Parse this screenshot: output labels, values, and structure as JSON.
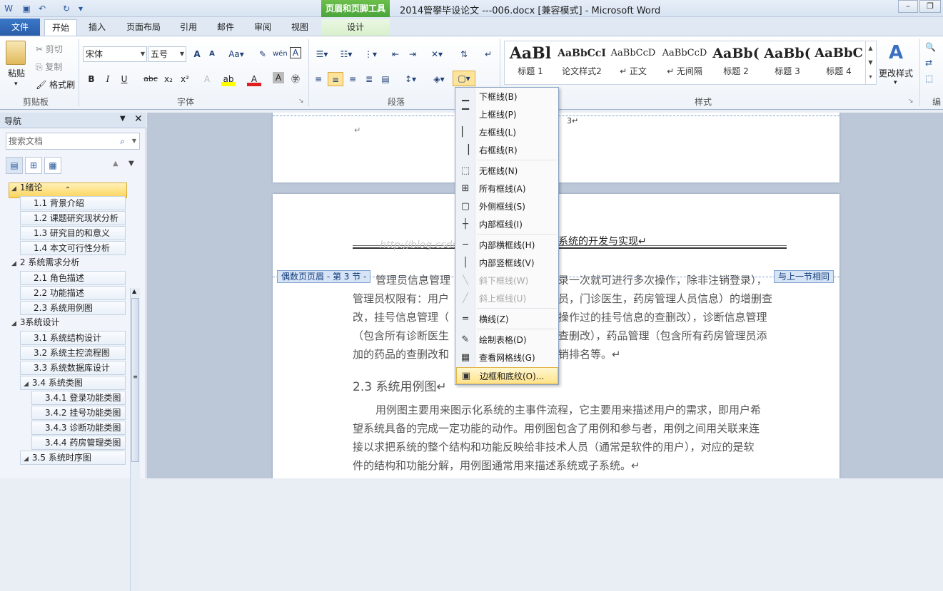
{
  "title_bar": {
    "context_tab_title": "页眉和页脚工具",
    "document_title": "2014管攀毕设论文 ---006.docx [兼容模式] - Microsoft Word"
  },
  "tabs": [
    "文件",
    "开始",
    "插入",
    "页面布局",
    "引用",
    "邮件",
    "审阅",
    "视图",
    "设计"
  ],
  "clipboard": {
    "paste": "粘贴",
    "cut": "剪切",
    "copy": "复制",
    "format_painter": "格式刷",
    "group_label": "剪贴板"
  },
  "font": {
    "font_name": "宋体",
    "font_size": "五号",
    "group_label": "字体"
  },
  "paragraph": {
    "group_label": "段落"
  },
  "styles": {
    "group_label": "样式",
    "items": [
      {
        "sample": "AaBl",
        "name": "标题 1"
      },
      {
        "sample": "AaBbCcI",
        "name": "论文样式2"
      },
      {
        "sample": "AaBbCcD",
        "name": "↵ 正文"
      },
      {
        "sample": "AaBbCcD",
        "name": "↵ 无间隔"
      },
      {
        "sample": "AaBb(",
        "name": "标题 2"
      },
      {
        "sample": "AaBb(",
        "name": "标题 3"
      },
      {
        "sample": "AaBbC",
        "name": "标题 4"
      }
    ],
    "change_styles": "更改样式",
    "edit_label": "编"
  },
  "navigation": {
    "title": "导航",
    "search_placeholder": "搜索文档",
    "tree": [
      {
        "label": "1绪论",
        "level": 1,
        "expanded": true
      },
      {
        "label": "1.1 背景介绍",
        "level": 2
      },
      {
        "label": "1.2 课题研究现状分析",
        "level": 2
      },
      {
        "label": "1.3 研究目的和意义",
        "level": 2
      },
      {
        "label": "1.4 本文可行性分析",
        "level": 2
      },
      {
        "label": "2 系统需求分析",
        "level": 1,
        "expanded": true
      },
      {
        "label": "2.1 角色描述",
        "level": 2
      },
      {
        "label": "2.2 功能描述",
        "level": 2
      },
      {
        "label": "2.3 系统用例图",
        "level": 2
      },
      {
        "label": "3系统设计",
        "level": 1,
        "expanded": true
      },
      {
        "label": "3.1 系统结构设计",
        "level": 2
      },
      {
        "label": "3.2 系统主控流程图",
        "level": 2
      },
      {
        "label": "3.3 系统数据库设计",
        "level": 2
      },
      {
        "label": "3.4 系统类图",
        "level": 2,
        "expanded": true
      },
      {
        "label": "3.4.1 登录功能类图",
        "level": 3
      },
      {
        "label": "3.4.2 挂号功能类图",
        "level": 3
      },
      {
        "label": "3.4.3 诊断功能类图",
        "level": 3
      },
      {
        "label": "3.4.4 药房管理类图",
        "level": 3
      },
      {
        "label": "3.5 系统时序图",
        "level": 2,
        "expanded": true
      }
    ]
  },
  "document": {
    "page_number": "3↵",
    "header_text": "系统的开发与实现↵",
    "header_badge_left": "偶数页页眉 - 第 3 节 -",
    "header_badge_right": "与上一节相同",
    "watermark": "http://blog.csdn.net/yisu",
    "body_lines": [
      "管理员信息管理",
      "录一次就可进行多次操作，除非注销登录），",
      "管理员权限有：用户",
      "员，门诊医生，药房管理人员信息）的增删查",
      "改，挂号信息管理（",
      "操作过的挂号信息的查删改），诊断信息管理",
      "（包含所有诊断医生",
      "查删改），药品管理（包含所有药房管理员添",
      "加的药品的查删改和",
      "销排名等。↵"
    ],
    "heading": "2.3 系统用例图↵",
    "para2_lines": [
      "用例图主要用来图示化系统的主事件流程，它主要用来描述用户的需求，即用户希",
      "望系统具备的完成一定功能的动作。用例图包含了用例和参与者，用例之间用关联来连",
      "接以求把系统的整个结构和功能反映给非技术人员（通常是软件的用户），对应的是软",
      "件的结构和功能分解，用例图通常用来描述系统或子系统。↵"
    ]
  },
  "border_menu": {
    "items": [
      {
        "label": "下框线(B)",
        "icon": "bottom-border-icon",
        "disabled": false
      },
      {
        "label": "上框线(P)",
        "icon": "top-border-icon",
        "disabled": false
      },
      {
        "label": "左框线(L)",
        "icon": "left-border-icon",
        "disabled": false
      },
      {
        "label": "右框线(R)",
        "icon": "right-border-icon",
        "disabled": false
      },
      {
        "label": "无框线(N)",
        "icon": "no-border-icon",
        "disabled": false
      },
      {
        "label": "所有框线(A)",
        "icon": "all-borders-icon",
        "disabled": false
      },
      {
        "label": "外侧框线(S)",
        "icon": "outside-borders-icon",
        "disabled": false
      },
      {
        "label": "内部框线(I)",
        "icon": "inside-borders-icon",
        "disabled": false
      },
      {
        "label": "内部横框线(H)",
        "icon": "inside-horizontal-border-icon",
        "disabled": false
      },
      {
        "label": "内部竖框线(V)",
        "icon": "inside-vertical-border-icon",
        "disabled": false
      },
      {
        "label": "斜下框线(W)",
        "icon": "diagonal-down-border-icon",
        "disabled": true
      },
      {
        "label": "斜上框线(U)",
        "icon": "diagonal-up-border-icon",
        "disabled": true
      },
      {
        "label": "横线(Z)",
        "icon": "horizontal-line-icon",
        "disabled": false
      },
      {
        "label": "绘制表格(D)",
        "icon": "draw-table-icon",
        "disabled": false
      },
      {
        "label": "查看网格线(G)",
        "icon": "view-gridlines-icon",
        "disabled": false
      },
      {
        "label": "边框和底纹(O)...",
        "icon": "borders-shading-icon",
        "disabled": false,
        "highlighted": true
      }
    ]
  },
  "colors": {
    "accent": "#2a5da8",
    "context_tab": "#4aa43a",
    "highlight": "#ffe38a"
  }
}
